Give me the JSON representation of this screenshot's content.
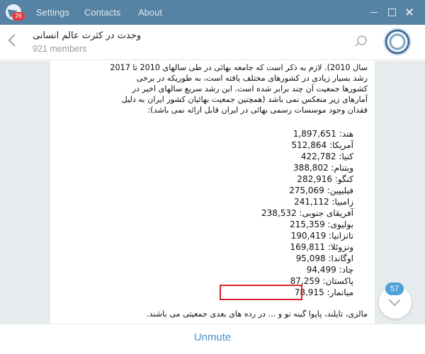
{
  "window": {
    "badge": "26",
    "menu": [
      "Settings",
      "Contacts",
      "About"
    ]
  },
  "chat": {
    "title": "وحدت در کثرت عالم انسانی",
    "members": "921 members"
  },
  "message": {
    "intro_lines": [
      "سال 2010). لازم به ذکر است که جامعه بهائی در طی سالهای 2010 تا 2017",
      "رشد بسیار زیادی در کشورهای مختلف یافته است، به طوریکه در برخی",
      "کشورها جمعیت آن چند برابر شده است. این رشد سریع سالهای اخیر در",
      "آمارهای زیر منعکس نمی باشد (همچنین جمعیت بهائیان کشور ایران به دلیل",
      "فقدان وجود موسسات رسمی بهائی در ایران قابل ارائه نمی باشد):"
    ],
    "stats": [
      "هند: 1,897,651",
      "آمریکا: 512,864",
      "کنیا: 422,782",
      "ویتنام: 388,802",
      "کنگو: 282,916",
      "فیلیپین: 275,069",
      "زامبیا: 241,112",
      "آفریقای جنوبی: 238,532",
      "بولیوی: 215,359",
      "تانزانیا: 190,419",
      "ونزوئلا: 169,811",
      "اوگاندا: 95,098",
      "چاد: 94,499",
      "پاکستان: 87,259",
      "میانمار: 78,915"
    ],
    "outro_line": "مالزی، تایلند، پاپوا گینه نو و ... در رده های بعدی جمعیتی می باشند."
  },
  "scroll": {
    "unread": "57"
  },
  "footer": {
    "action": "Unmute"
  },
  "colors": {
    "titlebar": "#5682a3",
    "highlight": "#d8202c",
    "accent": "#4a90c6",
    "badge": "#4da2d8"
  }
}
